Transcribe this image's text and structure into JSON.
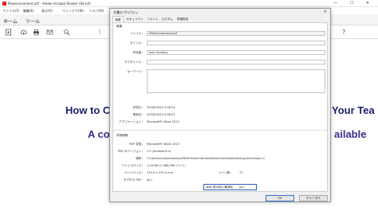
{
  "window": {
    "title": "MakeLinearized.pdf - Adobe Acrobat Reader (64-bit)",
    "controls": "—  ☐  ✕"
  },
  "menu": [
    "ファイル(F)",
    "編集(E)",
    "表示(V)",
    "ウィンドウ(W)",
    "ヘルプ(H)"
  ],
  "app_tabs": [
    "ホーム",
    "ツール"
  ],
  "toolbar": {
    "icons": [
      "create-icon",
      "upload-icon",
      "print-icon",
      "mail-icon",
      "search-icon"
    ],
    "partial_text": "(",
    "help": "?"
  },
  "document": {
    "heading_left": "How to C",
    "heading_right": "Your Tea",
    "sub_left": "A co",
    "sub_right": "ailable"
  },
  "dialog": {
    "title": "文書のプロパティ",
    "close": "✕",
    "tabs": [
      "概要",
      "セキュリティ",
      "フォント",
      "カスタム",
      "詳細設定"
    ],
    "section_overview": "概要",
    "file_label": "ファイル：",
    "file_value": "MakeLinearized.pdf",
    "title_label": "タイトル：",
    "title_value": "",
    "author_label": "作成者：",
    "author_value": "Jody Handley",
    "subject_label": "サブタイトル：",
    "subject_value": "",
    "keywords_label": "キーワード：",
    "keywords_value": "",
    "created_label": "作成日：",
    "created_value": "2018/04/24 0:58:31",
    "modified_label": "更新日：",
    "modified_value": "2018/04/24 0:58:31",
    "app_label": "アプリケーション：",
    "app_value": "Microsoft® Word 2013",
    "section_advanced": "詳細情報",
    "producer_label": "PDF 変換：",
    "producer_value": "Microsoft® Word 2013",
    "version_label": "PDF のバージョン：",
    "version_value": "1.5 (Acrobat 6.x)",
    "location_label": "場所：",
    "location_value": "C:\\Users\\taun\\Downloads\\ceTePdf-MakeLinearized\\MakeLinearized\\bin\\Debug\\netcoreapp3.1\\",
    "size_label": "ファイルサイズ：",
    "size_value": "1.04 MB (1,088,496 バイト)",
    "page_size_label": "ページサイズ：",
    "page_size_value": "215.9 x 279.4 mm",
    "pages_label": "ページ数：",
    "pages_value": "72",
    "tagged_label": "タグ付き PDF：",
    "tagged_value": "はい",
    "fast_web_label": "Web 表示用に最適化：",
    "fast_web_value": "はい",
    "ok": "OK",
    "cancel": "キャンセル"
  },
  "colors": {
    "heading": "#1a1f6e",
    "subheading": "#3a2c8a",
    "highlight_border": "#2d5db8"
  }
}
